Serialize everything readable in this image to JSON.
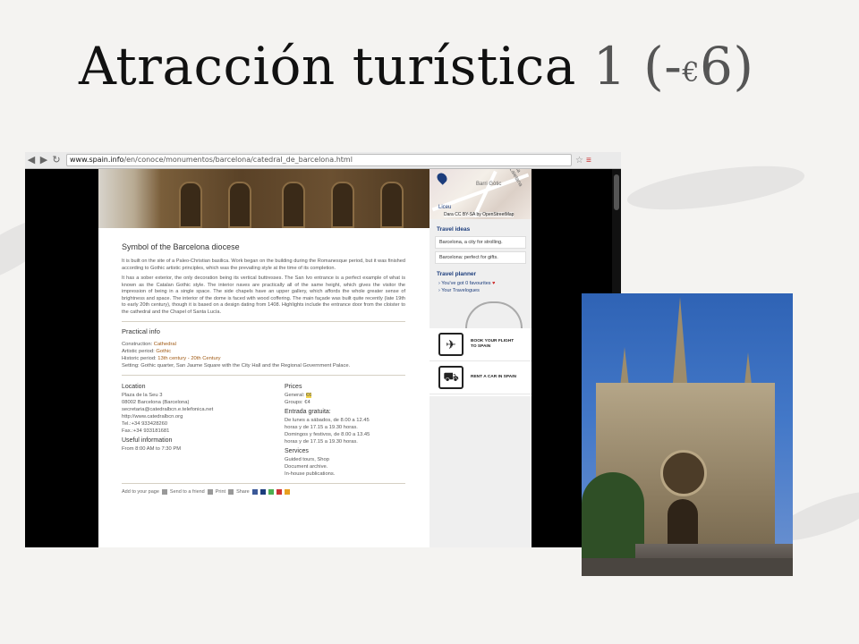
{
  "slide": {
    "title_main": "Atracción turística ",
    "title_num": "1",
    "title_price_open": " (-",
    "title_euro": "€",
    "title_price_close": "6)"
  },
  "browser": {
    "url_host": "www.spain.info",
    "url_path": "/en/conoce/monumentos/barcelona/catedral_de_barcelona.html",
    "icons": [
      "back-icon",
      "forward-icon",
      "reload-icon",
      "star-icon",
      "menu-icon"
    ]
  },
  "map": {
    "label1": "Barri Gòtic",
    "label2": "Liceu",
    "label3": "Via Laietana",
    "credit": "Dara CC BY-SA by OpenStreetMap"
  },
  "article": {
    "heading": "Symbol of the Barcelona diocese",
    "para1": "It is built on the site of a Paleo-Christian basilica. Work began on the building during the Romanesque period, but it was finished according to Gothic artistic principles, which was the prevailing style at the time of its completion.",
    "para2": "It has a sober exterior, the only decoration being its vertical buttresses. The San Ivo entrance is a perfect example of what is known as the Catalan Gothic style. The interior naves are practically all of the same height, which gives the visitor the impression of being in a single space. The side chapels have an upper gallery, which affords the whole greater sense of brightness and space. The interior of the dome is faced with wood coffering. The main façade was built quite recently (late 19th to early 20th century), though it is based on a design dating from 1408. Highlights include the entrance door from the cloister to the cathedral and the Chapel of Santa Lucía."
  },
  "practical": {
    "heading": "Practical info",
    "construction_label": "Construction: ",
    "construction_value": "Cathedral",
    "artistic_label": "Artistic period: ",
    "artistic_value": "Gothic",
    "historic_label": "Historic period: ",
    "historic_value": "13th century - 20th Century",
    "setting": "Setting: Gothic quarter, San Jaume Square with the City Hall and the Regional Government Palace."
  },
  "location": {
    "heading": "Location",
    "lines": [
      "Plaza de la Seu 3",
      "08002 Barcelona (Barcelona)",
      "secretaria@catedralbcn.e.telefonica.net",
      "http://www.catedralbcn.org",
      "Tel.:+34 933428260",
      "Fax.:+34 933181681"
    ]
  },
  "useful": {
    "heading": "Useful information",
    "text": "From 8:00 AM to 7:30 PM"
  },
  "prices": {
    "heading": "Prices",
    "general_label": "General: ",
    "general_value": "€6",
    "groups": "Groups: €4"
  },
  "entrada": {
    "heading": "Entrada gratuita:",
    "lines": [
      "De lunes a sábados, de 8.00 a 12.45",
      "horas y de 17.15 a 19.30 horas.",
      "Domingos y festivos, de 8.00 a 13.45",
      "horas y de 17.15 a 19.30 horas."
    ]
  },
  "services": {
    "heading": "Services",
    "lines": [
      "Guided tours, Shop",
      "Document archive.",
      "In-house publications."
    ]
  },
  "share_bar": {
    "add": "Add to your page",
    "send": "Send to a friend",
    "print": "Print",
    "share": "Share"
  },
  "sidebar": {
    "travel_ideas": "Travel ideas",
    "idea1": "Barcelona, a city for strolling.",
    "idea2": "Barcelona: perfect for gifts.",
    "planner": "Travel planner",
    "favourites": "You've got 0 favourites",
    "travelogues": "Your Travelogues",
    "flight": "BOOK YOUR FLIGHT TO SPAIN",
    "car": "RENT A CAR IN SPAIN"
  }
}
